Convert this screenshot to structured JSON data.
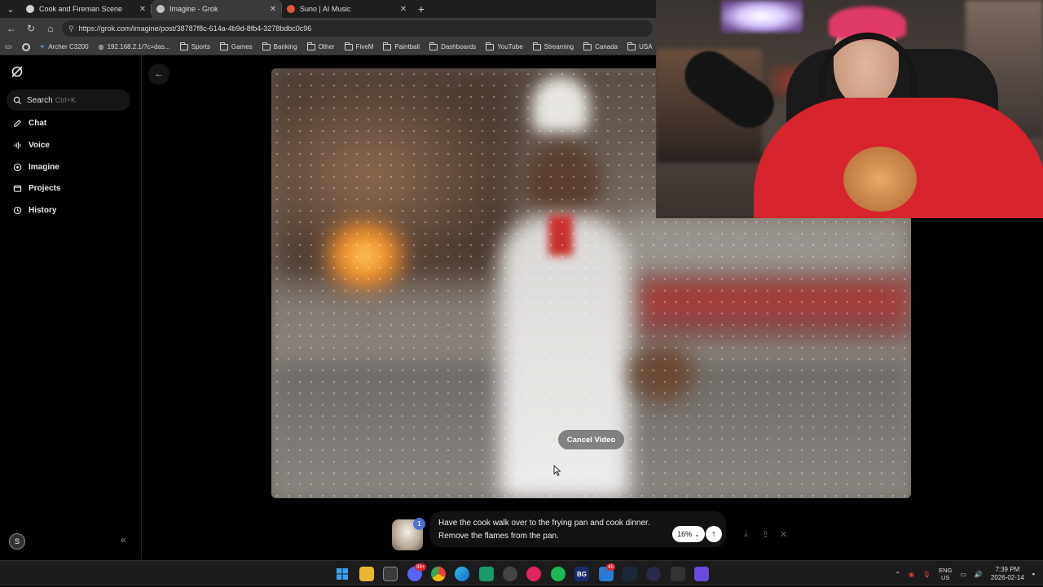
{
  "browser": {
    "tabs": [
      {
        "title": "Cook and Fireman Scene",
        "active": false,
        "favicon_color": "#d0d0d0"
      },
      {
        "title": "Imagine - Grok",
        "active": true,
        "favicon_color": "#bfbfbf"
      },
      {
        "title": "Suno | AI Music",
        "active": false,
        "favicon_color": "#e0563a"
      }
    ],
    "url": "https://grok.com/imagine/post/38787f8c-614a-4b9d-8fb4-3278bdbc0c96",
    "bookmarks": [
      {
        "label": "Archer C3200",
        "icon": "router-icon"
      },
      {
        "label": "192.168.2.1/?c=das...",
        "icon": "globe-icon"
      },
      {
        "label": "Sports",
        "icon": "folder-icon"
      },
      {
        "label": "Games",
        "icon": "folder-icon"
      },
      {
        "label": "Banking",
        "icon": "folder-icon"
      },
      {
        "label": "Other",
        "icon": "folder-icon"
      },
      {
        "label": "FiveM",
        "icon": "folder-icon"
      },
      {
        "label": "Paintball",
        "icon": "folder-icon"
      },
      {
        "label": "Dashboards",
        "icon": "folder-icon"
      },
      {
        "label": "YouTube",
        "icon": "folder-icon"
      },
      {
        "label": "Streaming",
        "icon": "folder-icon"
      },
      {
        "label": "Canada",
        "icon": "folder-icon"
      },
      {
        "label": "USA",
        "icon": "folder-icon"
      }
    ]
  },
  "sidebar": {
    "search": {
      "label": "Search",
      "shortcut": "Ctrl+K"
    },
    "items": [
      {
        "label": "Chat",
        "icon": "chat-icon"
      },
      {
        "label": "Voice",
        "icon": "voice-icon"
      },
      {
        "label": "Imagine",
        "icon": "imagine-icon"
      },
      {
        "label": "Projects",
        "icon": "projects-icon"
      },
      {
        "label": "History",
        "icon": "history-icon"
      }
    ],
    "avatar_initial": "S"
  },
  "video": {
    "cancel_label": "Cancel Video"
  },
  "prompt": {
    "line1": "Have the cook walk over to the frying pan and cook dinner.",
    "line2": "Remove the flames from the pan.",
    "badge": "1",
    "progress_label": "16%"
  },
  "taskbar": {
    "badges": {
      "discord": "99+",
      "app45": "45"
    },
    "language": {
      "line1": "ENG",
      "line2": "US"
    },
    "time": "7:39 PM",
    "date": "2026-02-14",
    "bg_app_label": "BG"
  }
}
